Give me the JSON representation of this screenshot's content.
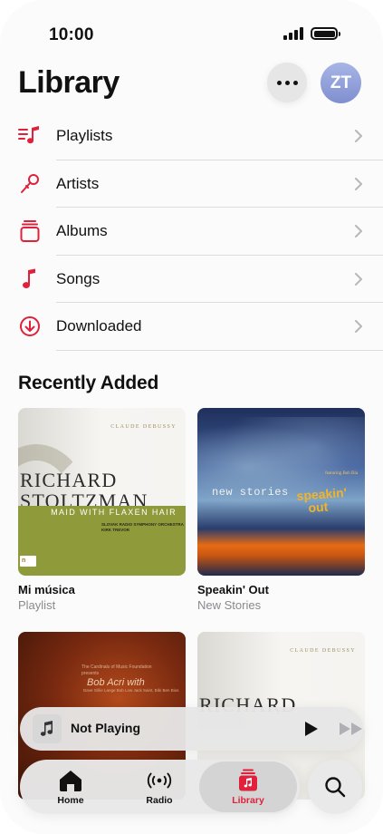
{
  "status_bar": {
    "time": "10:00"
  },
  "header": {
    "title": "Library",
    "avatar_initials": "ZT"
  },
  "menu": {
    "items": [
      {
        "label": "Playlists",
        "icon": "playlist-icon"
      },
      {
        "label": "Artists",
        "icon": "microphone-icon"
      },
      {
        "label": "Albums",
        "icon": "album-stack-icon"
      },
      {
        "label": "Songs",
        "icon": "music-note-icon"
      },
      {
        "label": "Downloaded",
        "icon": "download-circle-icon"
      }
    ]
  },
  "recently_added": {
    "title": "Recently Added",
    "albums": [
      {
        "title": "Mi música",
        "subtitle": "Playlist",
        "cover": {
          "composer": "CLAUDE DEBUSSY",
          "name_line1": "RICHARD",
          "name_line2": "STOLTZMAN",
          "work": "MAID WITH FLAXEN HAIR",
          "credits_line1": "SLOVAK RADIO SYMPHONY ORCHESTRA",
          "credits_line2": "KIRK TREVOR",
          "label": "n"
        }
      },
      {
        "title": "Speakin' Out",
        "subtitle": "New Stories",
        "cover": {
          "small_text": "featuring Bob Bla",
          "band": "new stories",
          "title_line1": "speakin'",
          "title_line2": "out"
        }
      },
      {
        "title": "",
        "subtitle": "",
        "cover": {
          "top_text": "The Cardinals of Music Foundation presents",
          "artist": "Bob Acri with",
          "bottom_text": "Dave Gillie Lange Bob Low Jack Saint, Bibi Ben Bios"
        }
      },
      {
        "title": "",
        "subtitle": "",
        "cover": {
          "composer": "CLAUDE DEBUSSY",
          "name_line1": "RICHARD"
        }
      }
    ]
  },
  "mini_player": {
    "title": "Not Playing"
  },
  "tab_bar": {
    "tabs": [
      {
        "label": "Home"
      },
      {
        "label": "Radio"
      },
      {
        "label": "Library"
      }
    ]
  },
  "colors": {
    "accent": "#e0213b",
    "background": "#fbfbfb",
    "avatar": "#8d9bd8"
  }
}
